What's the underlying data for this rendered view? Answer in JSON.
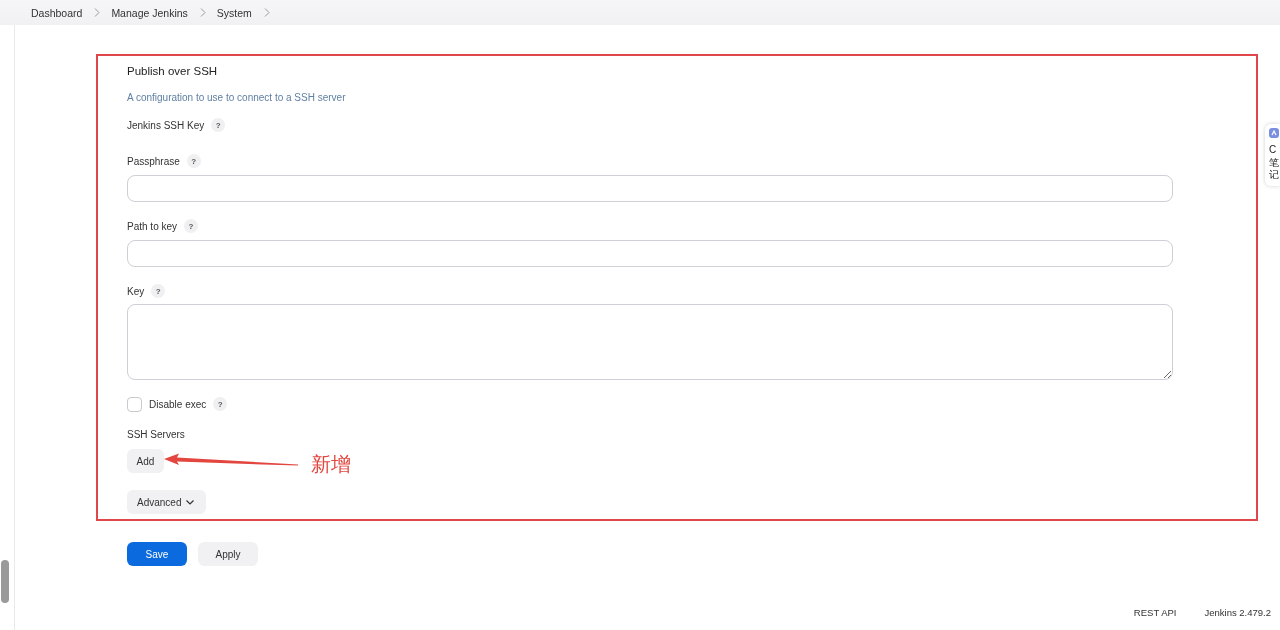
{
  "breadcrumb": [
    {
      "label": "Dashboard"
    },
    {
      "label": "Manage Jenkins"
    },
    {
      "label": "System"
    }
  ],
  "section": {
    "title": "Publish over SSH",
    "description": "A configuration to use to connect to a SSH server",
    "fields": [
      {
        "kind": "heading",
        "label": "Jenkins SSH Key",
        "help": "?"
      },
      {
        "kind": "text",
        "label": "Passphrase",
        "help": "?"
      },
      {
        "kind": "text",
        "label": "Path to key",
        "help": "?"
      },
      {
        "kind": "textarea",
        "label": "Key",
        "help": "?"
      },
      {
        "kind": "checkbox",
        "label": "Disable exec",
        "help": "?",
        "checked": false
      }
    ],
    "ssh_servers": {
      "label": "SSH Servers",
      "button": "Add"
    },
    "advanced_button": "Advanced"
  },
  "annotation": {
    "text": "新增"
  },
  "buttons": [
    {
      "label": "Save",
      "kind": "primary"
    },
    {
      "label": "Apply",
      "kind": "secondary"
    }
  ],
  "footer": [
    {
      "label": "REST API"
    },
    {
      "label": "Jenkins 2.479.2"
    }
  ],
  "side_widget": {
    "lines": [
      "C",
      "笔",
      "记"
    ]
  }
}
